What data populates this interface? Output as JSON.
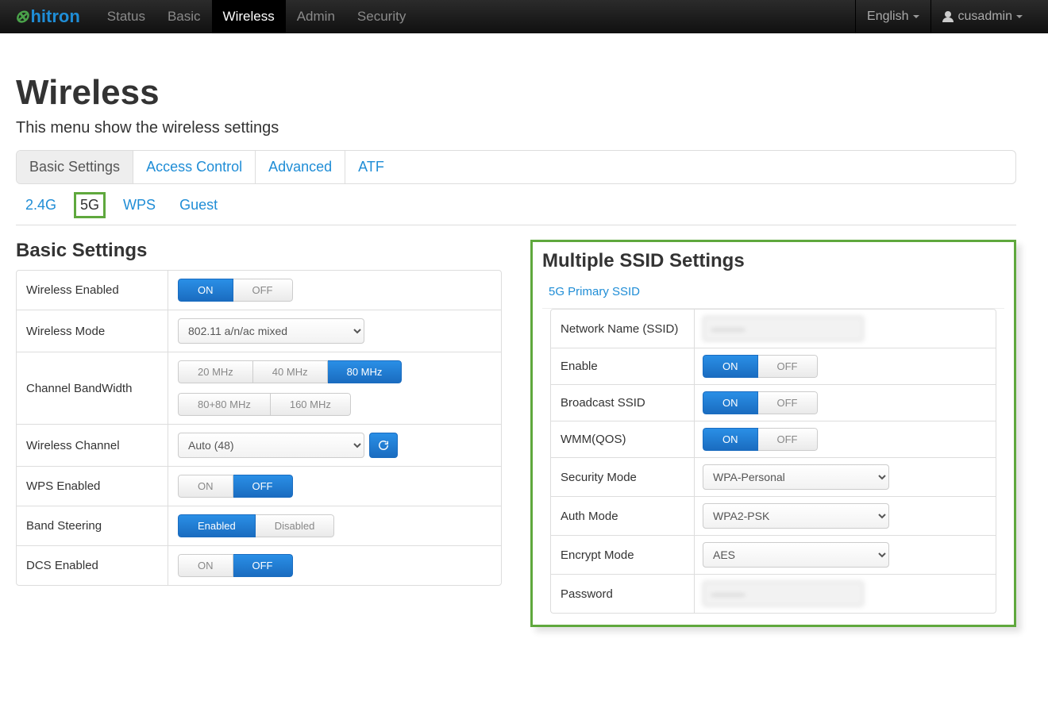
{
  "brand": "hitron",
  "nav": {
    "items": [
      {
        "label": "Status",
        "active": false
      },
      {
        "label": "Basic",
        "active": false
      },
      {
        "label": "Wireless",
        "active": true
      },
      {
        "label": "Admin",
        "active": false
      },
      {
        "label": "Security",
        "active": false
      }
    ],
    "language": "English",
    "username": "cusadmin"
  },
  "page": {
    "title": "Wireless",
    "subtitle": "This menu show the wireless settings"
  },
  "tabs1": [
    {
      "label": "Basic Settings",
      "active": true
    },
    {
      "label": "Access Control",
      "active": false
    },
    {
      "label": "Advanced",
      "active": false
    },
    {
      "label": "ATF",
      "active": false
    }
  ],
  "tabs2": [
    {
      "label": "2.4G",
      "active": false,
      "highlight": false
    },
    {
      "label": "5G",
      "active": true,
      "highlight": true
    },
    {
      "label": "WPS",
      "active": false,
      "highlight": false
    },
    {
      "label": "Guest",
      "active": false,
      "highlight": false
    }
  ],
  "sections": {
    "basic": {
      "title": "Basic Settings",
      "rows": {
        "wirelessEnabled": {
          "label": "Wireless Enabled",
          "on": "ON",
          "off": "OFF",
          "value": "ON"
        },
        "wirelessMode": {
          "label": "Wireless Mode",
          "value": "802.11 a/n/ac mixed"
        },
        "channelBandwidth": {
          "label": "Channel BandWidth",
          "options": [
            "20 MHz",
            "40 MHz",
            "80 MHz",
            "80+80 MHz",
            "160 MHz"
          ],
          "value": "80 MHz"
        },
        "wirelessChannel": {
          "label": "Wireless Channel",
          "value": "Auto (48)"
        },
        "wpsEnabled": {
          "label": "WPS Enabled",
          "on": "ON",
          "off": "OFF",
          "value": "OFF"
        },
        "bandSteering": {
          "label": "Band Steering",
          "on": "Enabled",
          "off": "Disabled",
          "value": "Enabled"
        },
        "dcsEnabled": {
          "label": "DCS Enabled",
          "on": "ON",
          "off": "OFF",
          "value": "OFF"
        }
      }
    },
    "ssid": {
      "title": "Multiple SSID Settings",
      "tab": "5G Primary SSID",
      "rows": {
        "networkName": {
          "label": "Network Name (SSID)",
          "value": "———"
        },
        "enable": {
          "label": "Enable",
          "on": "ON",
          "off": "OFF",
          "value": "ON"
        },
        "broadcast": {
          "label": "Broadcast SSID",
          "on": "ON",
          "off": "OFF",
          "value": "ON"
        },
        "wmm": {
          "label": "WMM(QOS)",
          "on": "ON",
          "off": "OFF",
          "value": "ON"
        },
        "securityMode": {
          "label": "Security Mode",
          "value": "WPA-Personal"
        },
        "authMode": {
          "label": "Auth Mode",
          "value": "WPA2-PSK"
        },
        "encryptMode": {
          "label": "Encrypt Mode",
          "value": "AES"
        },
        "password": {
          "label": "Password",
          "value": "———"
        }
      }
    }
  }
}
